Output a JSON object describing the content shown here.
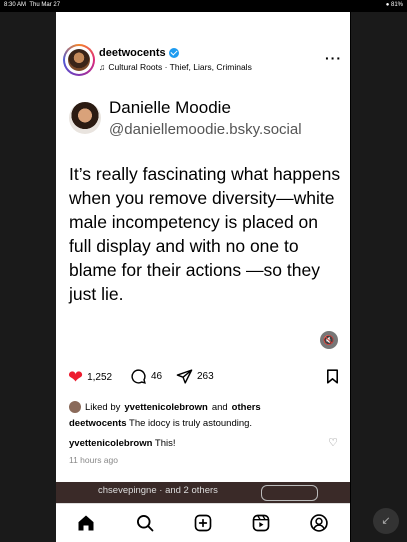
{
  "status": {
    "time": "8:30 AM",
    "date": "Thu Mar 27",
    "battery": "81%"
  },
  "post": {
    "username": "deetwocents",
    "music": "Cultural Roots · Thief, Liars, Criminals"
  },
  "embedded": {
    "name": "Danielle Moodie",
    "handle": "@daniellemoodie.bsky.social",
    "text": "It’s really fascinating what happens when you remove diversity—white male incompetency is placed on full display and with no one to blame for their actions —so they just lie."
  },
  "actions": {
    "likes": "1,252",
    "comments": "46",
    "shares": "263"
  },
  "liked_by": {
    "prefix": "Liked by",
    "user": "yvettenicolebrown",
    "and": "and",
    "others": "others"
  },
  "caption": {
    "user": "deetwocents",
    "text": "The idocy is truly astounding."
  },
  "comment": {
    "user": "yvettenicolebrown",
    "text": "This!"
  },
  "time_ago": "11 hours ago",
  "next_post": {
    "text": "chsevepingne · and 2 others"
  },
  "icons": {
    "verified": "verified-badge-icon",
    "music": "music-note-icon",
    "more": "more-dots-icon",
    "mute": "muted-speaker-icon",
    "heart": "heart-icon",
    "comment": "comment-bubble-icon",
    "share": "send-icon",
    "bookmark": "bookmark-icon",
    "home": "home-icon",
    "search": "search-icon",
    "create": "create-post-icon",
    "reels": "reels-icon",
    "profile": "profile-icon",
    "expand": "collapse-arrows-icon"
  },
  "colors": {
    "like": "#ed1c2f",
    "verified": "#1d9bf0"
  }
}
